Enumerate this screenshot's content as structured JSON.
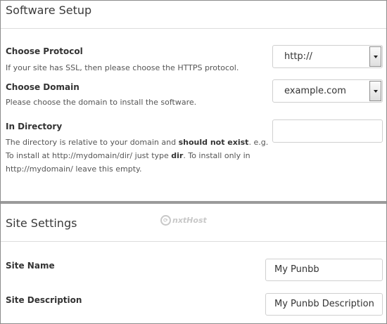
{
  "software_setup": {
    "title": "Software Setup",
    "protocol": {
      "label": "Choose Protocol",
      "description": "If your site has SSL, then please choose the HTTPS protocol.",
      "selected": "http://"
    },
    "domain": {
      "label": "Choose Domain",
      "description": "Please choose the domain to install the software.",
      "selected": "example.com"
    },
    "directory": {
      "label": "In Directory",
      "desc_part1": "The directory is relative to your domain and ",
      "desc_bold1": "should not exist",
      "desc_part2": ". e.g. To install at http://mydomain/dir/ just type ",
      "desc_bold2": "dir",
      "desc_part3": ". To install only in http://mydomain/ leave this empty.",
      "value": ""
    }
  },
  "site_settings": {
    "title": "Site Settings",
    "watermark": "nxtHost",
    "site_name": {
      "label": "Site Name",
      "value": "My Punbb"
    },
    "site_description": {
      "label": "Site Description",
      "value": "My Punbb Description"
    }
  },
  "icons": {
    "watermark_logo": "nxthost-logo-icon",
    "select_arrow": "chevron-down-icon"
  },
  "colors": {
    "heavy_divider": "#9a9a9a",
    "light_divider": "#dcdcdc",
    "frame_border": "#8c8c8c"
  }
}
